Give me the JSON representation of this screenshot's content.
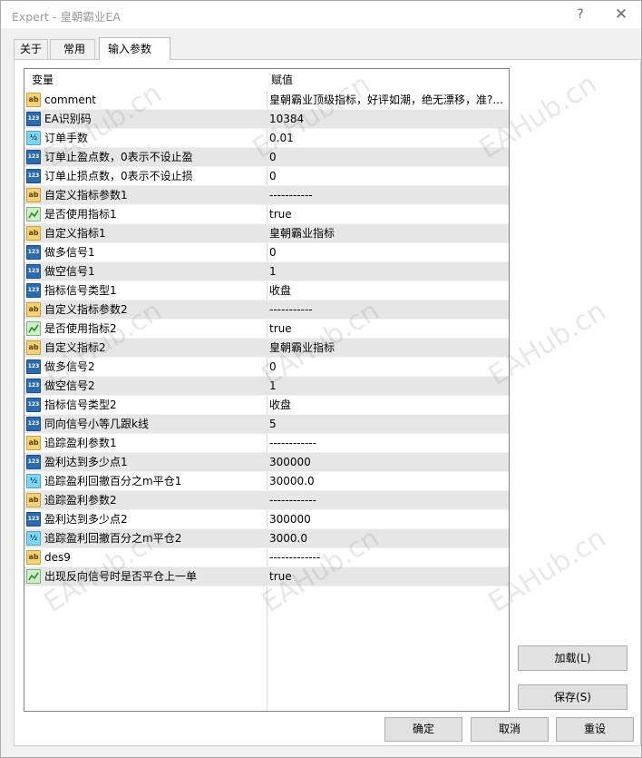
{
  "window": {
    "title": "Expert - 皇朝霸业EA",
    "help": "?",
    "close": "✕"
  },
  "tabs": [
    {
      "label": "关于"
    },
    {
      "label": "常用"
    },
    {
      "label": "输入参数"
    }
  ],
  "table": {
    "headers": {
      "name": "变量",
      "value": "赋值"
    },
    "rows": [
      {
        "icon": "ab",
        "name": "comment",
        "value": "皇朝霸业顶级指标，好评如潮，绝无漂移，准?..."
      },
      {
        "icon": "123",
        "name": "EA识别码",
        "value": "10384"
      },
      {
        "icon": "v2",
        "name": "订单手数",
        "value": "0.01"
      },
      {
        "icon": "123",
        "name": "订单止盈点数，0表示不设止盈",
        "value": "0"
      },
      {
        "icon": "123",
        "name": "订单止损点数，0表示不设止损",
        "value": "0"
      },
      {
        "icon": "ab",
        "name": "自定义指标参数1",
        "value": "-----------"
      },
      {
        "icon": "bool",
        "name": "是否使用指标1",
        "value": "true"
      },
      {
        "icon": "ab",
        "name": "自定义指标1",
        "value": "皇朝霸业指标"
      },
      {
        "icon": "123",
        "name": "做多信号1",
        "value": "0"
      },
      {
        "icon": "123",
        "name": "做空信号1",
        "value": "1"
      },
      {
        "icon": "123",
        "name": "指标信号类型1",
        "value": "收盘"
      },
      {
        "icon": "ab",
        "name": "自定义指标参数2",
        "value": "-----------"
      },
      {
        "icon": "bool",
        "name": "是否使用指标2",
        "value": "true"
      },
      {
        "icon": "ab",
        "name": "自定义指标2",
        "value": "皇朝霸业指标"
      },
      {
        "icon": "123",
        "name": "做多信号2",
        "value": "0"
      },
      {
        "icon": "123",
        "name": "做空信号2",
        "value": "1"
      },
      {
        "icon": "123",
        "name": "指标信号类型2",
        "value": "收盘"
      },
      {
        "icon": "123",
        "name": "同向信号小等几跟k线",
        "value": "5"
      },
      {
        "icon": "ab",
        "name": "追踪盈利参数1",
        "value": "------------"
      },
      {
        "icon": "123",
        "name": "盈利达到多少点1",
        "value": "300000"
      },
      {
        "icon": "v2",
        "name": "追踪盈利回撤百分之m平仓1",
        "value": "30000.0"
      },
      {
        "icon": "ab",
        "name": "追踪盈利参数2",
        "value": "------------"
      },
      {
        "icon": "123",
        "name": "盈利达到多少点2",
        "value": "300000"
      },
      {
        "icon": "v2",
        "name": "追踪盈利回撤百分之m平仓2",
        "value": "3000.0"
      },
      {
        "icon": "ab",
        "name": "des9",
        "value": "-------------"
      },
      {
        "icon": "bool",
        "name": "出现反向信号时是否平仓上一单",
        "value": "true"
      }
    ]
  },
  "buttons": {
    "load": "加载(L)",
    "save": "保存(S)",
    "ok": "确定",
    "cancel": "取消",
    "reset": "重设"
  },
  "watermark": "EAHub.cn",
  "icon_labels": {
    "ab": "ab",
    "123": "123",
    "v2": "½"
  }
}
